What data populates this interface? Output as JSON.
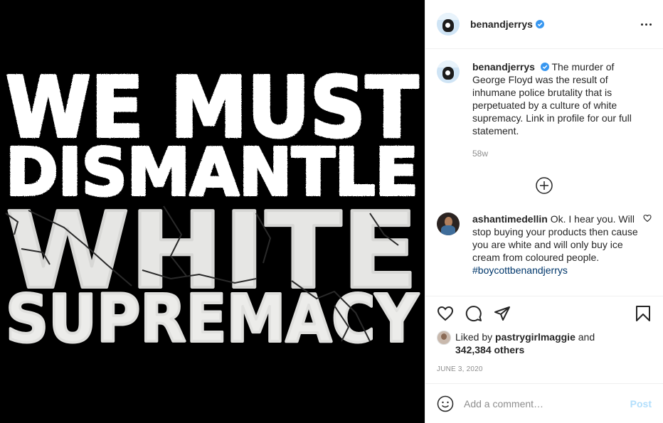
{
  "post": {
    "image_text": {
      "line1": "WE MUST",
      "line2": "DISMANTLE",
      "line3": "WHITE",
      "line4": "SUPREMACY"
    },
    "colors": {
      "media_bg": "#000000",
      "verified": "#3897f0",
      "link": "#00376b",
      "post_button": "#b2dffc"
    }
  },
  "header": {
    "username": "benandjerrys",
    "verified_icon": "verified-badge-icon",
    "more_icon": "more-options-icon"
  },
  "caption": {
    "username": "benandjerrys",
    "text": "The murder of George Floyd was the result of inhumane police brutality that is perpetuated by a culture of white supremacy. Link in profile for our full statement.",
    "time": "58w"
  },
  "load_more_icon": "plus-circle-icon",
  "comments": [
    {
      "username": "ashantimedellin",
      "text": "Ok. I hear you. Will stop buying your products then cause you are white and will only buy ice cream from coloured people.",
      "hashtag": "#boycottbenandjerrys"
    }
  ],
  "likes": {
    "prefix": "Liked by ",
    "user": "pastrygirlmaggie",
    "middle": " and",
    "count": "342,384 others"
  },
  "date": "JUNE 3, 2020",
  "add_comment": {
    "placeholder": "Add a comment…",
    "post_label": "Post"
  }
}
